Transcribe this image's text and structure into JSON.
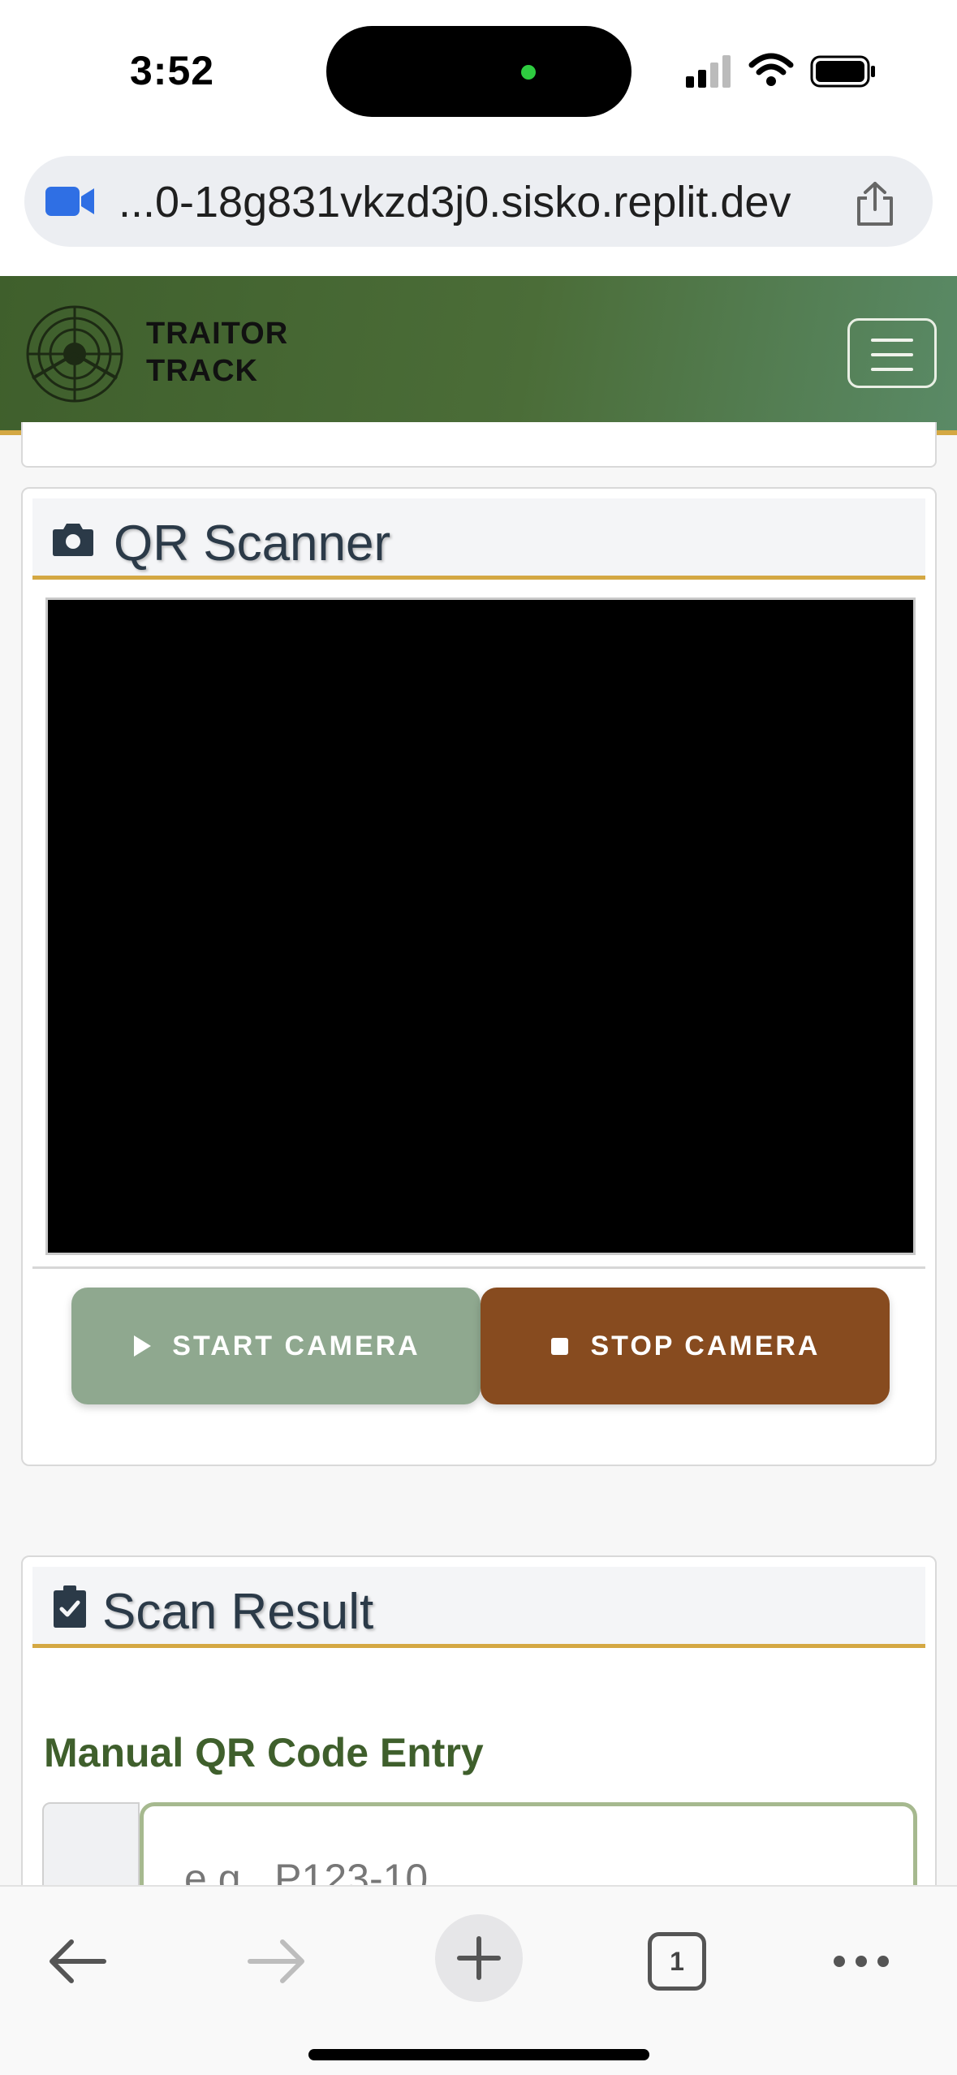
{
  "status_bar": {
    "time": "3:52"
  },
  "browser": {
    "url": "...0-18g831vkzd3j0.sisko.replit.dev",
    "tab_count": "1"
  },
  "navbar": {
    "brand_line1": "TRAITOR",
    "brand_line2": "TRACK"
  },
  "scanner": {
    "title": "QR Scanner",
    "start_label": "START CAMERA",
    "stop_label": "STOP CAMERA"
  },
  "result": {
    "title": "Scan Result",
    "manual_title": "Manual QR Code Entry",
    "input_placeholder": "e.g., P123-10"
  },
  "colors": {
    "navbar_green": "#4b6d38",
    "accent_gold": "#d4a843",
    "start_button": "#8fa88f",
    "stop_button": "#874b1f",
    "heading_green": "#3f5f2c"
  }
}
